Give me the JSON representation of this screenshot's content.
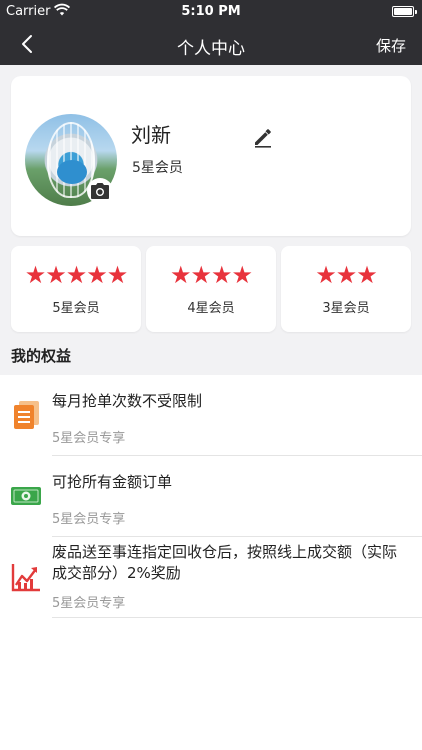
{
  "status_bar": {
    "carrier": "Carrier",
    "time": "5:10 PM"
  },
  "nav": {
    "title": "个人中心",
    "save_label": "保存"
  },
  "profile": {
    "name": "刘新",
    "level": "5星会员"
  },
  "levels": [
    {
      "stars": "★★★★★",
      "label": "5星会员"
    },
    {
      "stars": "★★★★",
      "label": "4星会员"
    },
    {
      "stars": "★★★",
      "label": "3星会员"
    }
  ],
  "benefits_title": "我的权益",
  "benefits": [
    {
      "icon": "document-icon",
      "title": "每月抢单次数不受限制",
      "subtitle": "5星会员专享"
    },
    {
      "icon": "cash-icon",
      "title": "可抢所有金额订单",
      "subtitle": "5星会员专享"
    },
    {
      "icon": "trend-chart-icon",
      "title": "废品送至事连指定回收仓后，按照线上成交额（实际成交部分）2%奖励",
      "subtitle": "5星会员专享"
    }
  ],
  "colors": {
    "nav_bg": "#2f2f33",
    "star": "#e8333c",
    "page_bg": "#f2f2f4"
  }
}
